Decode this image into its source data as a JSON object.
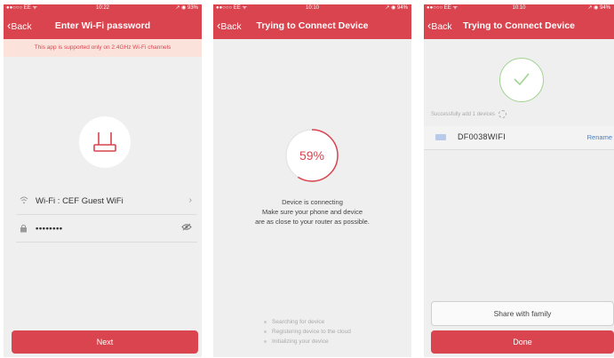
{
  "screen1": {
    "status": {
      "carrier": "●●○○○ EE ᯤ",
      "time": "10:22",
      "right": "↗ ◉ 93%"
    },
    "back_label": "Back",
    "title": "Enter Wi-Fi password",
    "banner": "This app is supported only on 2.4GHz Wi-Fi channels",
    "wifi_label": "Wi-Fi : CEF Guest WiFi",
    "password_value": "••••••••",
    "next_label": "Next"
  },
  "screen2": {
    "status": {
      "carrier": "●●○○○ EE ᯤ",
      "time": "10:10",
      "right": "↗ ◉ 94%"
    },
    "back_label": "Back",
    "title": "Trying to Connect Device",
    "progress_text": "59%",
    "progress": 0.59,
    "message": [
      "Device is connecting",
      "Make sure your phone and device",
      "are as close to your router as possible."
    ],
    "steps": [
      "Searching for device",
      "Registering device to the cloud",
      "Initializing your device"
    ]
  },
  "screen3": {
    "status": {
      "carrier": "●●○○○ EE ᯤ",
      "time": "10:10",
      "right": "↗ ◉ 94%"
    },
    "back_label": "Back",
    "title": "Trying to Connect Device",
    "success_text": "Successfully add 1 devices",
    "device_name": "DF0038WIFI",
    "rename_label": "Rename",
    "share_label": "Share with family",
    "done_label": "Done"
  },
  "colors": {
    "accent": "#d9444e",
    "banner_bg": "#fbe3dc",
    "link": "#3f7fd1",
    "success": "#9fd48f"
  },
  "icons": [
    "chevron-left-icon",
    "router-icon",
    "wifi-icon",
    "lock-icon",
    "chevron-right-icon",
    "eye-off-icon",
    "check-icon",
    "spinner-icon",
    "device-icon"
  ]
}
